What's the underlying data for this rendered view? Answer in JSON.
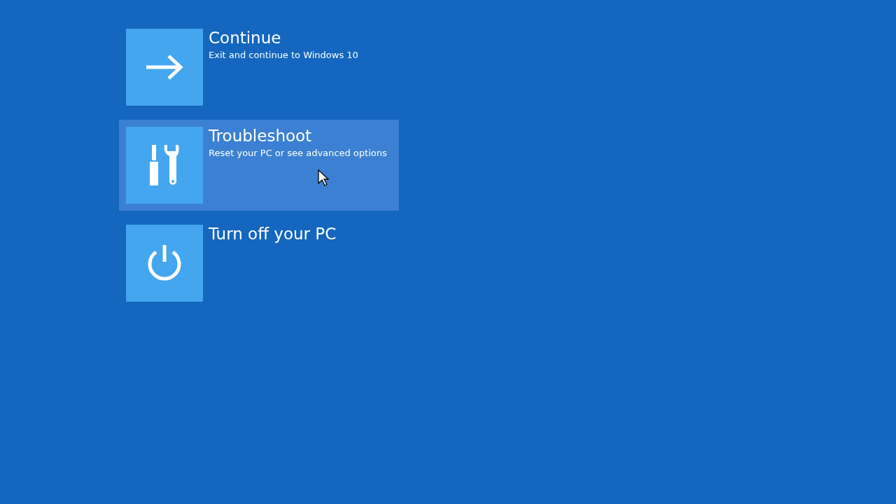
{
  "options": [
    {
      "kind": "arrow",
      "title": "Continue",
      "description": "Exit and continue to Windows 10",
      "selected": false
    },
    {
      "kind": "tools",
      "title": "Troubleshoot",
      "description": "Reset your PC or see advanced options",
      "selected": true
    },
    {
      "kind": "power",
      "title": "Turn off your PC",
      "selected": false
    }
  ]
}
